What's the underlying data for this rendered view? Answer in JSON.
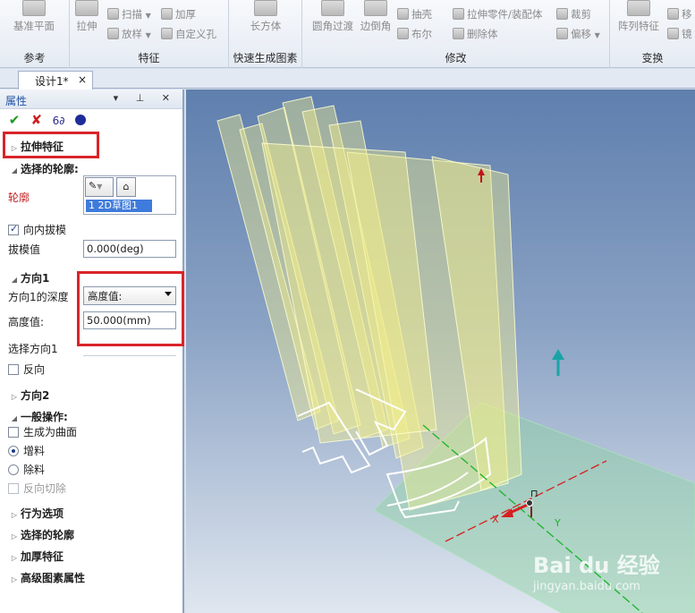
{
  "ribbon": {
    "groups": [
      {
        "label": "参考",
        "big": [
          {
            "label": "基准平面"
          }
        ]
      },
      {
        "label": "特征",
        "big": [
          {
            "label": "拉伸"
          }
        ],
        "small": [
          {
            "label": "扫描"
          },
          {
            "label": "放样"
          },
          {
            "label": "加厚"
          },
          {
            "label": "自定义孔"
          }
        ]
      },
      {
        "label": "快速生成图素",
        "big": [
          {
            "label": "长方体"
          }
        ]
      },
      {
        "label": "修改",
        "big": [
          {
            "label": "圆角过渡"
          },
          {
            "label": "边倒角"
          }
        ],
        "small": [
          {
            "label": "抽壳"
          },
          {
            "label": "布尔"
          },
          {
            "label": "拉伸零件/装配体"
          },
          {
            "label": "删除体"
          },
          {
            "label": "裁剪"
          },
          {
            "label": "偏移"
          }
        ]
      },
      {
        "label": "变换",
        "big": [
          {
            "label": "阵列特征"
          }
        ],
        "small": [
          {
            "label": "移"
          },
          {
            "label": "镜"
          }
        ]
      }
    ]
  },
  "tabs": [
    {
      "label": "设计1*",
      "close": "×"
    }
  ],
  "panel": {
    "title": "属性",
    "header_buttons": "▾ ⊥ ✕",
    "extrude_feature": "拉伸特征",
    "selected_profile_section": "选择的轮廓:",
    "profile_label": "轮廓",
    "profile_list_item": "1    2D草图1",
    "inward_draft": "向内拔模",
    "draft_value_label": "拔模值",
    "draft_value": "0.000(deg)",
    "direction1": "方向1",
    "direction1_depth_label": "方向1的深度",
    "depth_type": "高度值:",
    "height_label": "高度值:",
    "height_value": "50.000(mm)",
    "select_direction1": "选择方向1",
    "reverse": "反向",
    "direction2": "方向2",
    "general_ops": "一般操作:",
    "generate_surface": "生成为曲面",
    "add_material": "增料",
    "remove_material": "除料",
    "reverse_cut": "反向切除",
    "behavior_options": "行为选项",
    "selected_profile": "选择的轮廓",
    "thicken_feature": "加厚特征",
    "advanced_props": "高级图素属性"
  },
  "viewport": {
    "axis_x": "X",
    "axis_y": "Y",
    "watermark_logo": "Bai du 经验",
    "watermark_url": "jingyan.baidu.com"
  },
  "colors": {
    "highlight": "#d9242a",
    "panel_title": "#2153a3",
    "extrusion_fill": "#f2ee8a"
  }
}
